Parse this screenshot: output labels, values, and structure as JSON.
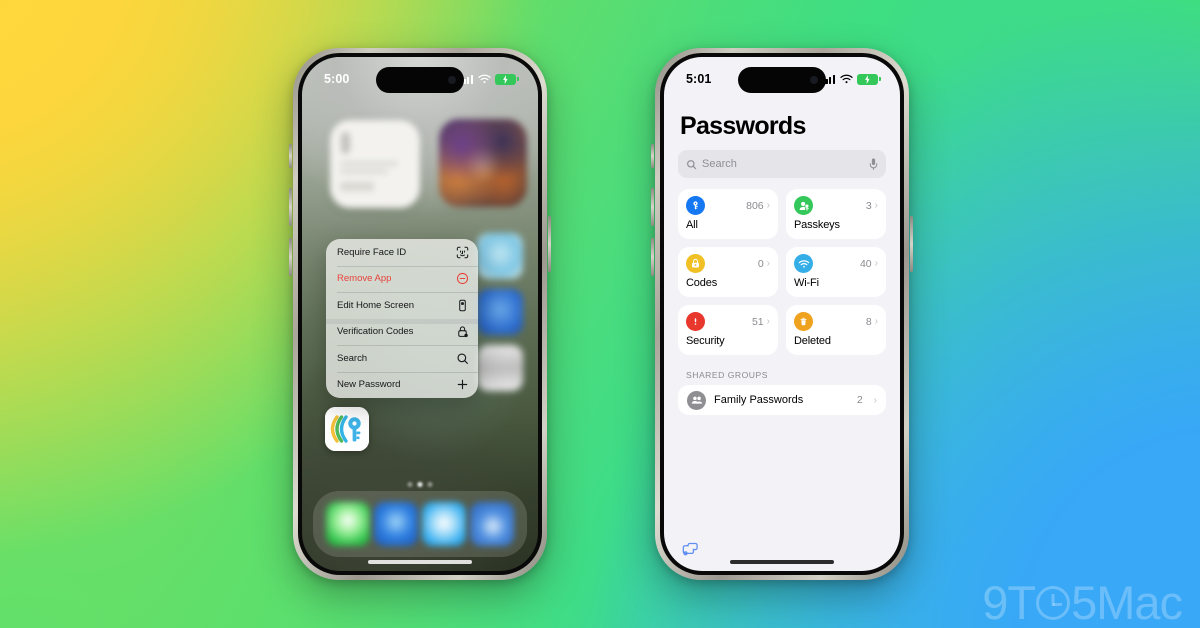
{
  "watermark": {
    "text_before": "9T",
    "text_after": "5Mac",
    "clock_icon": "clock-glyph"
  },
  "background": {
    "color_top_left": "#FCD63C",
    "color_top_right": "#3FE07A",
    "color_bottom_left": "#5FE06A",
    "color_bottom_right": "#38A8F7"
  },
  "left_phone": {
    "status_bar": {
      "time": "5:00",
      "signal_icon": "cellular-signal-icon",
      "wifi_icon": "wifi-icon",
      "battery_icon": "battery-charging-icon",
      "battery_color": "#34C759"
    },
    "home_screen": {
      "app_icon_label": "Passwords",
      "app_icon_name": "passwords-app-icon",
      "widgets": [
        "notes-widget",
        "photos-widget"
      ],
      "dock_icons": [
        "messages-icon",
        "safari-icon",
        "mail-icon",
        "app-store-icon"
      ],
      "page_dots": 3,
      "page_dot_active": 1
    },
    "context_menu": {
      "items": [
        {
          "label": "Require Face ID",
          "icon": "face-id-icon",
          "destructive": false,
          "separator_above": false
        },
        {
          "label": "Remove App",
          "icon": "remove-circle-icon",
          "destructive": true,
          "separator_above": false
        },
        {
          "label": "Edit Home Screen",
          "icon": "edit-home-screen-icon",
          "destructive": false,
          "separator_above": false
        },
        {
          "label": "Verification Codes",
          "icon": "lock-badge-icon",
          "destructive": false,
          "separator_above": true
        },
        {
          "label": "Search",
          "icon": "search-icon",
          "destructive": false,
          "separator_above": false
        },
        {
          "label": "New Password",
          "icon": "plus-icon",
          "destructive": false,
          "separator_above": false
        }
      ]
    }
  },
  "right_phone": {
    "status_bar": {
      "time": "5:01",
      "signal_icon": "cellular-signal-icon",
      "wifi_icon": "wifi-icon",
      "battery_icon": "battery-charging-icon",
      "battery_color": "#34C759"
    },
    "app": {
      "title": "Passwords",
      "search": {
        "placeholder": "Search",
        "value": "",
        "icon": "search-icon",
        "mic_icon": "microphone-icon"
      },
      "categories": [
        {
          "label": "All",
          "count": "806",
          "icon": "key-icon",
          "color": "#1578F2",
          "chevron": "›"
        },
        {
          "label": "Passkeys",
          "count": "3",
          "icon": "passkey-person-icon",
          "color": "#34C759",
          "chevron": "›"
        },
        {
          "label": "Codes",
          "count": "0",
          "icon": "code-lock-icon",
          "color": "#F0C024",
          "chevron": "›"
        },
        {
          "label": "Wi-Fi",
          "count": "40",
          "icon": "wifi-icon",
          "color": "#35AEE8",
          "chevron": "›"
        },
        {
          "label": "Security",
          "count": "51",
          "icon": "warning-icon",
          "color": "#E8382E",
          "chevron": "›"
        },
        {
          "label": "Deleted",
          "count": "8",
          "icon": "trash-icon",
          "color": "#EFA21E",
          "chevron": "›"
        }
      ],
      "shared_groups": {
        "header": "SHARED GROUPS",
        "rows": [
          {
            "name": "Family Passwords",
            "count": "2",
            "icon": "group-people-icon",
            "chevron": "›"
          }
        ]
      },
      "toolbar": {
        "options_icon": "password-options-icon",
        "options_color": "#5F8EF0"
      }
    }
  }
}
